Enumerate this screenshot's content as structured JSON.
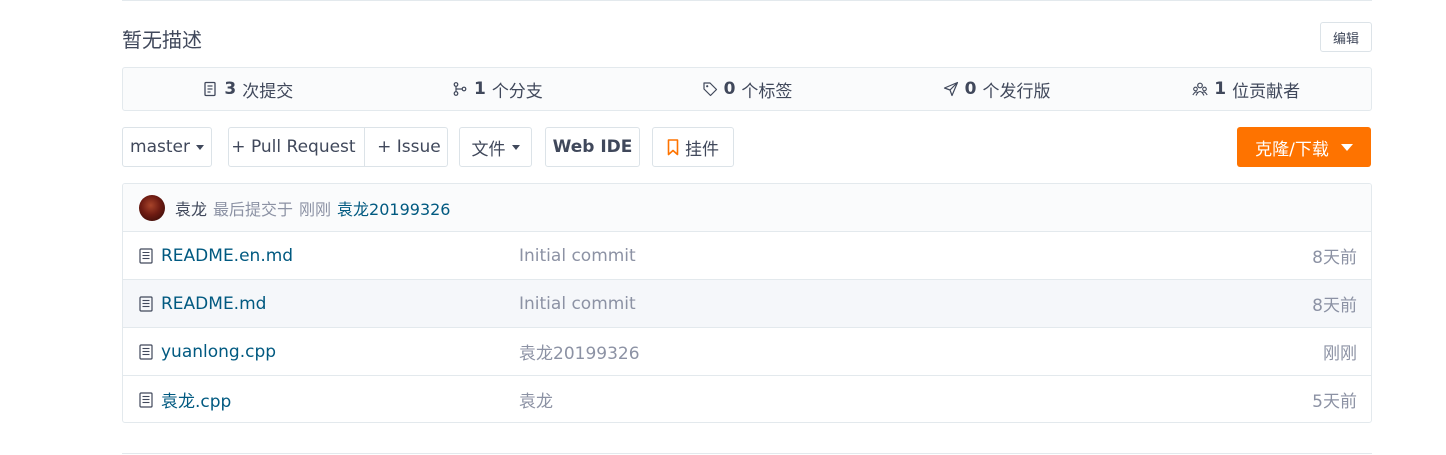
{
  "repo": {
    "description": "暂无描述",
    "edit_label": "编辑"
  },
  "stats": [
    {
      "icon": "commit-icon",
      "count": "3",
      "label": "次提交"
    },
    {
      "icon": "branch-icon",
      "count": "1",
      "label": "个分支"
    },
    {
      "icon": "tag-icon",
      "count": "0",
      "label": "个标签"
    },
    {
      "icon": "release-icon",
      "count": "0",
      "label": "个发行版"
    },
    {
      "icon": "contributors-icon",
      "count": "1",
      "label": "位贡献者"
    }
  ],
  "toolbar": {
    "branch": "master",
    "pull_request": "+ Pull Request",
    "issue": "+ Issue",
    "file": "文件",
    "web_ide": "Web IDE",
    "widget": "挂件",
    "clone": "克隆/下载"
  },
  "last_commit": {
    "author": "袁龙",
    "label": "最后提交于",
    "time": "刚刚",
    "message": "袁龙20199326"
  },
  "files": [
    {
      "name": "README.en.md",
      "message": "Initial commit",
      "time": "8天前"
    },
    {
      "name": "README.md",
      "message": "Initial commit",
      "time": "8天前"
    },
    {
      "name": "yuanlong.cpp",
      "message": "袁龙20199326",
      "time": "刚刚"
    },
    {
      "name": "袁龙.cpp",
      "message": "袁龙",
      "time": "5天前"
    }
  ],
  "colors": {
    "accent": "#fe7300",
    "link": "#005980",
    "muted": "#8c92a4"
  }
}
